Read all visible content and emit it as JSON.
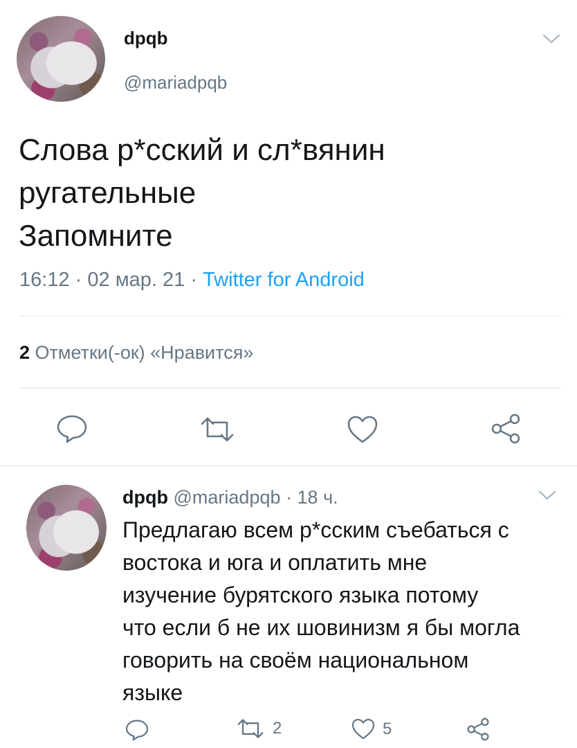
{
  "tweet": {
    "display_name": "dpqb",
    "handle": "@mariadpqb",
    "text_lines": [
      "Слова р*сский и сл*вянин",
      "ругательные",
      "Запомните"
    ],
    "time": "16:12",
    "date": "02 мар. 21",
    "separator": "·",
    "source": "Twitter for Android",
    "likes_count": "2",
    "likes_label": "Отметки(-ок) «Нравится»"
  },
  "reply": {
    "display_name": "dpqb",
    "handle": "@mariadpqb",
    "separator": "·",
    "time": "18 ч.",
    "text_lines": [
      "Предлагаю всем р*сским съебаться с",
      "востока и юга и оплатить мне",
      "изучение бурятского языка потому",
      "что если б не их шовинизм я бы могла",
      "говорить на своём национальном",
      "языке"
    ],
    "retweet_count": "2",
    "like_count": "5"
  },
  "icons": {
    "reply": "reply-icon",
    "retweet": "retweet-icon",
    "like": "heart-icon",
    "share": "share-icon",
    "more": "chevron-down-icon"
  },
  "colors": {
    "text": "#14171a",
    "muted": "#657786",
    "link": "#1da1f2",
    "divider": "#e1e8ed"
  }
}
